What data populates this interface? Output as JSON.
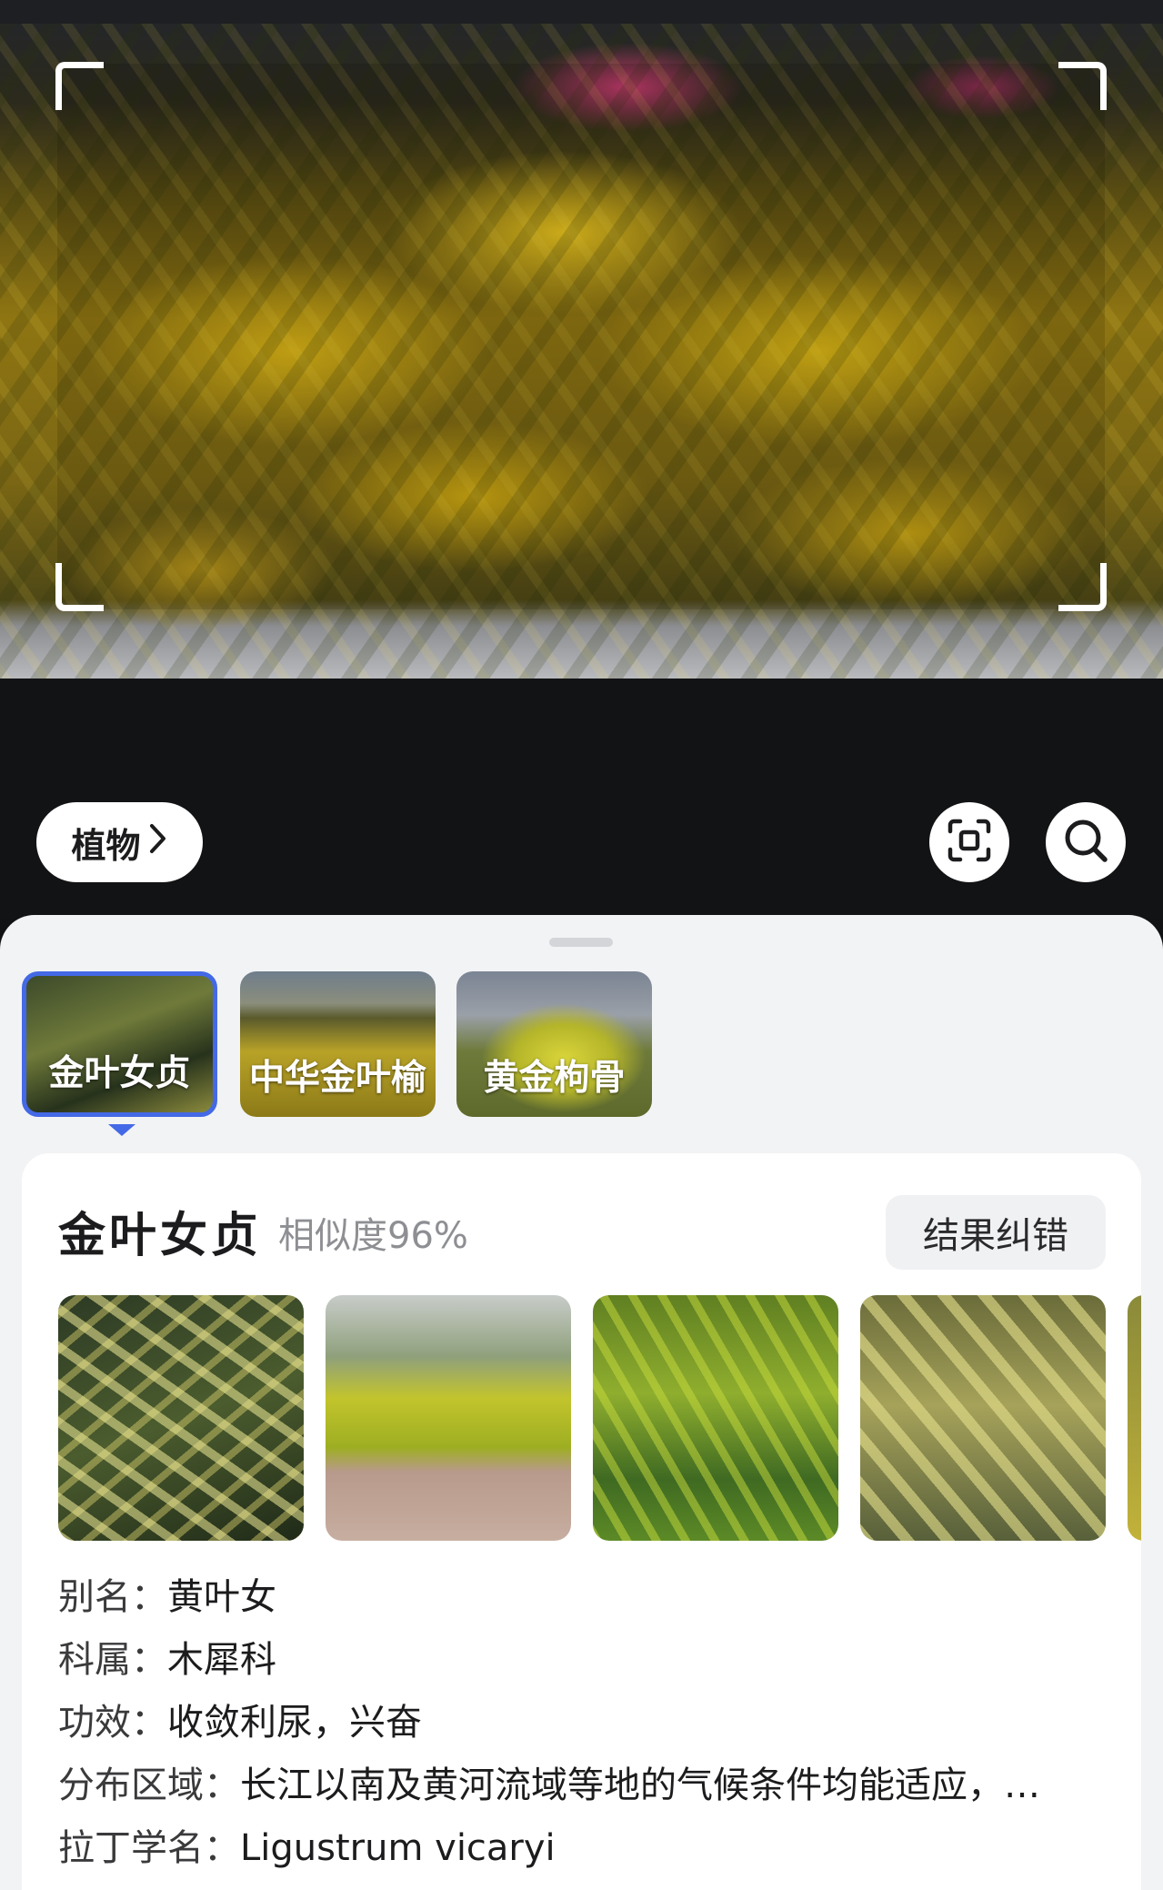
{
  "camera": {
    "category_label": "植物",
    "category_chevron": "›"
  },
  "candidates": [
    {
      "label": "金叶女贞",
      "selected": true
    },
    {
      "label": "中华金叶榆",
      "selected": false
    },
    {
      "label": "黄金枸骨",
      "selected": false
    }
  ],
  "result": {
    "name": "金叶女贞",
    "similarity": "相似度96%",
    "correct_label": "结果纠错",
    "gallery_count": 5,
    "info": [
      {
        "key": "别名：",
        "value": "黄叶女"
      },
      {
        "key": "科属：",
        "value": "木犀科"
      },
      {
        "key": "功效：",
        "value": "收敛利尿，兴奋"
      },
      {
        "key": "分布区域：",
        "value": "长江以南及黄河流域等地的气候条件均能适应，…"
      },
      {
        "key": "拉丁学名：",
        "value": "Ligustrum vicaryi"
      }
    ]
  },
  "colors": {
    "accent": "#4469e6",
    "sheet_bg": "#f2f3f5",
    "camera_bg": "#121315"
  },
  "icons": {
    "scan": "scan-frame-icon",
    "search": "search-icon",
    "chevron": "chevron-right-icon"
  }
}
